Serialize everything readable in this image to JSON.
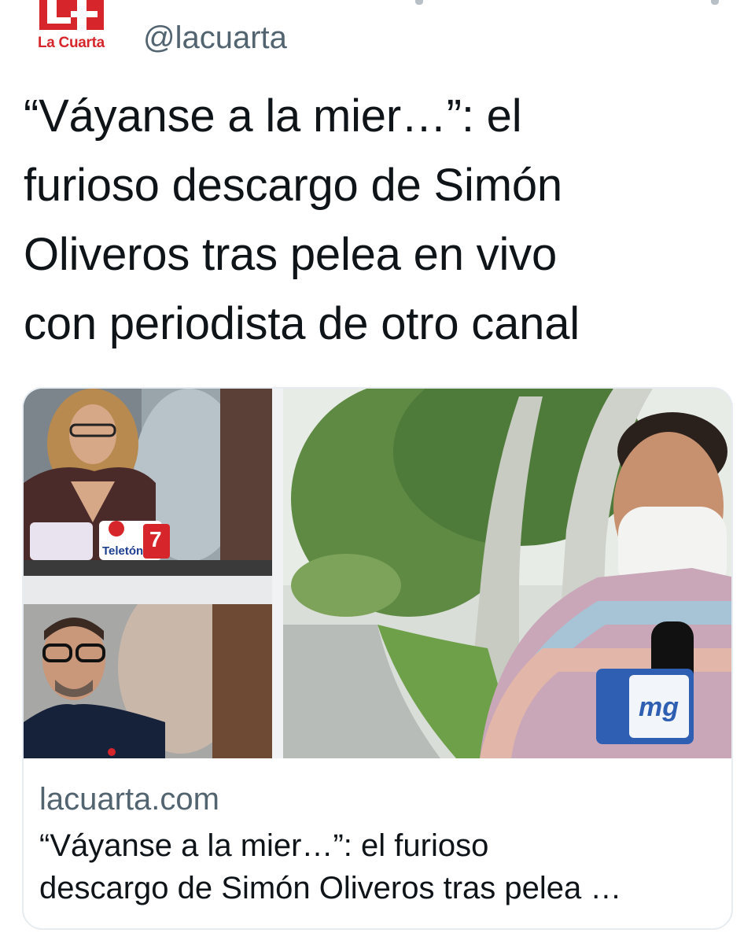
{
  "header": {
    "logo_mark": "L4",
    "logo_text": "La Cuarta",
    "handle": "@lacuarta"
  },
  "tweet": {
    "headline_lines": [
      "“Váyanse a la mier…”: el",
      "furioso descargo de Simón",
      "Oliveros tras pelea en vivo",
      "con periodista de otro canal"
    ]
  },
  "card": {
    "domain": "lacuarta.com",
    "title_lines": [
      "“Váyanse a la mier…”: el furioso",
      "descargo de Simón Oliveros tras pelea …"
    ],
    "image": {
      "sign_text": "Teletón",
      "channel_number": "7",
      "mic_logo": "mg"
    }
  },
  "colors": {
    "brand_red": "#d6262b",
    "handle_gray": "#536471",
    "text": "#0f1419",
    "card_border": "#e6ecf0"
  }
}
